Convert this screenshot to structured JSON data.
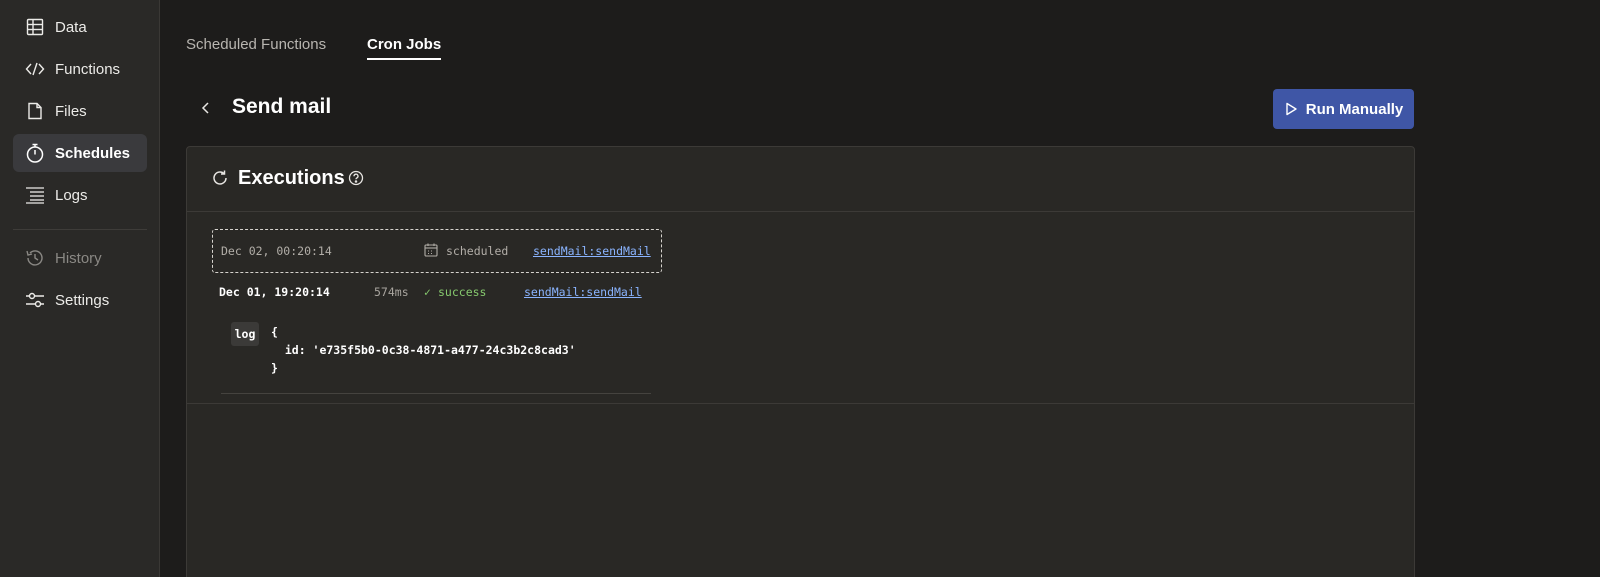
{
  "sidebar": {
    "items": [
      {
        "label": "Data",
        "icon": "table-icon"
      },
      {
        "label": "Functions",
        "icon": "code-icon"
      },
      {
        "label": "Files",
        "icon": "file-icon"
      },
      {
        "label": "Schedules",
        "icon": "stopwatch-icon",
        "active": true
      },
      {
        "label": "Logs",
        "icon": "list-icon"
      },
      {
        "label": "History",
        "icon": "history-icon",
        "disabled": true
      },
      {
        "label": "Settings",
        "icon": "sliders-icon"
      }
    ]
  },
  "tabs": [
    {
      "label": "Scheduled Functions"
    },
    {
      "label": "Cron Jobs",
      "active": true
    }
  ],
  "header": {
    "title": "Send mail",
    "run_button_label": "Run Manually"
  },
  "panel": {
    "title": "Executions",
    "executions": [
      {
        "date": "Dec 02, 00:20:14",
        "status": "scheduled",
        "function": "sendMail:sendMail"
      },
      {
        "date": "Dec 01, 19:20:14",
        "duration": "574ms",
        "status": "success",
        "function": "sendMail:sendMail",
        "log_label": "log",
        "log_lines": [
          "{",
          "  id: 'e735f5b0-0c38-4871-a477-24c3b2c8cad3'",
          "}"
        ]
      }
    ]
  },
  "colors": {
    "background": "#1d1c1b",
    "sidebar": "#2a2927",
    "accent_button": "#3f56a6",
    "link": "#8ab4ff",
    "success": "#86c96e"
  }
}
